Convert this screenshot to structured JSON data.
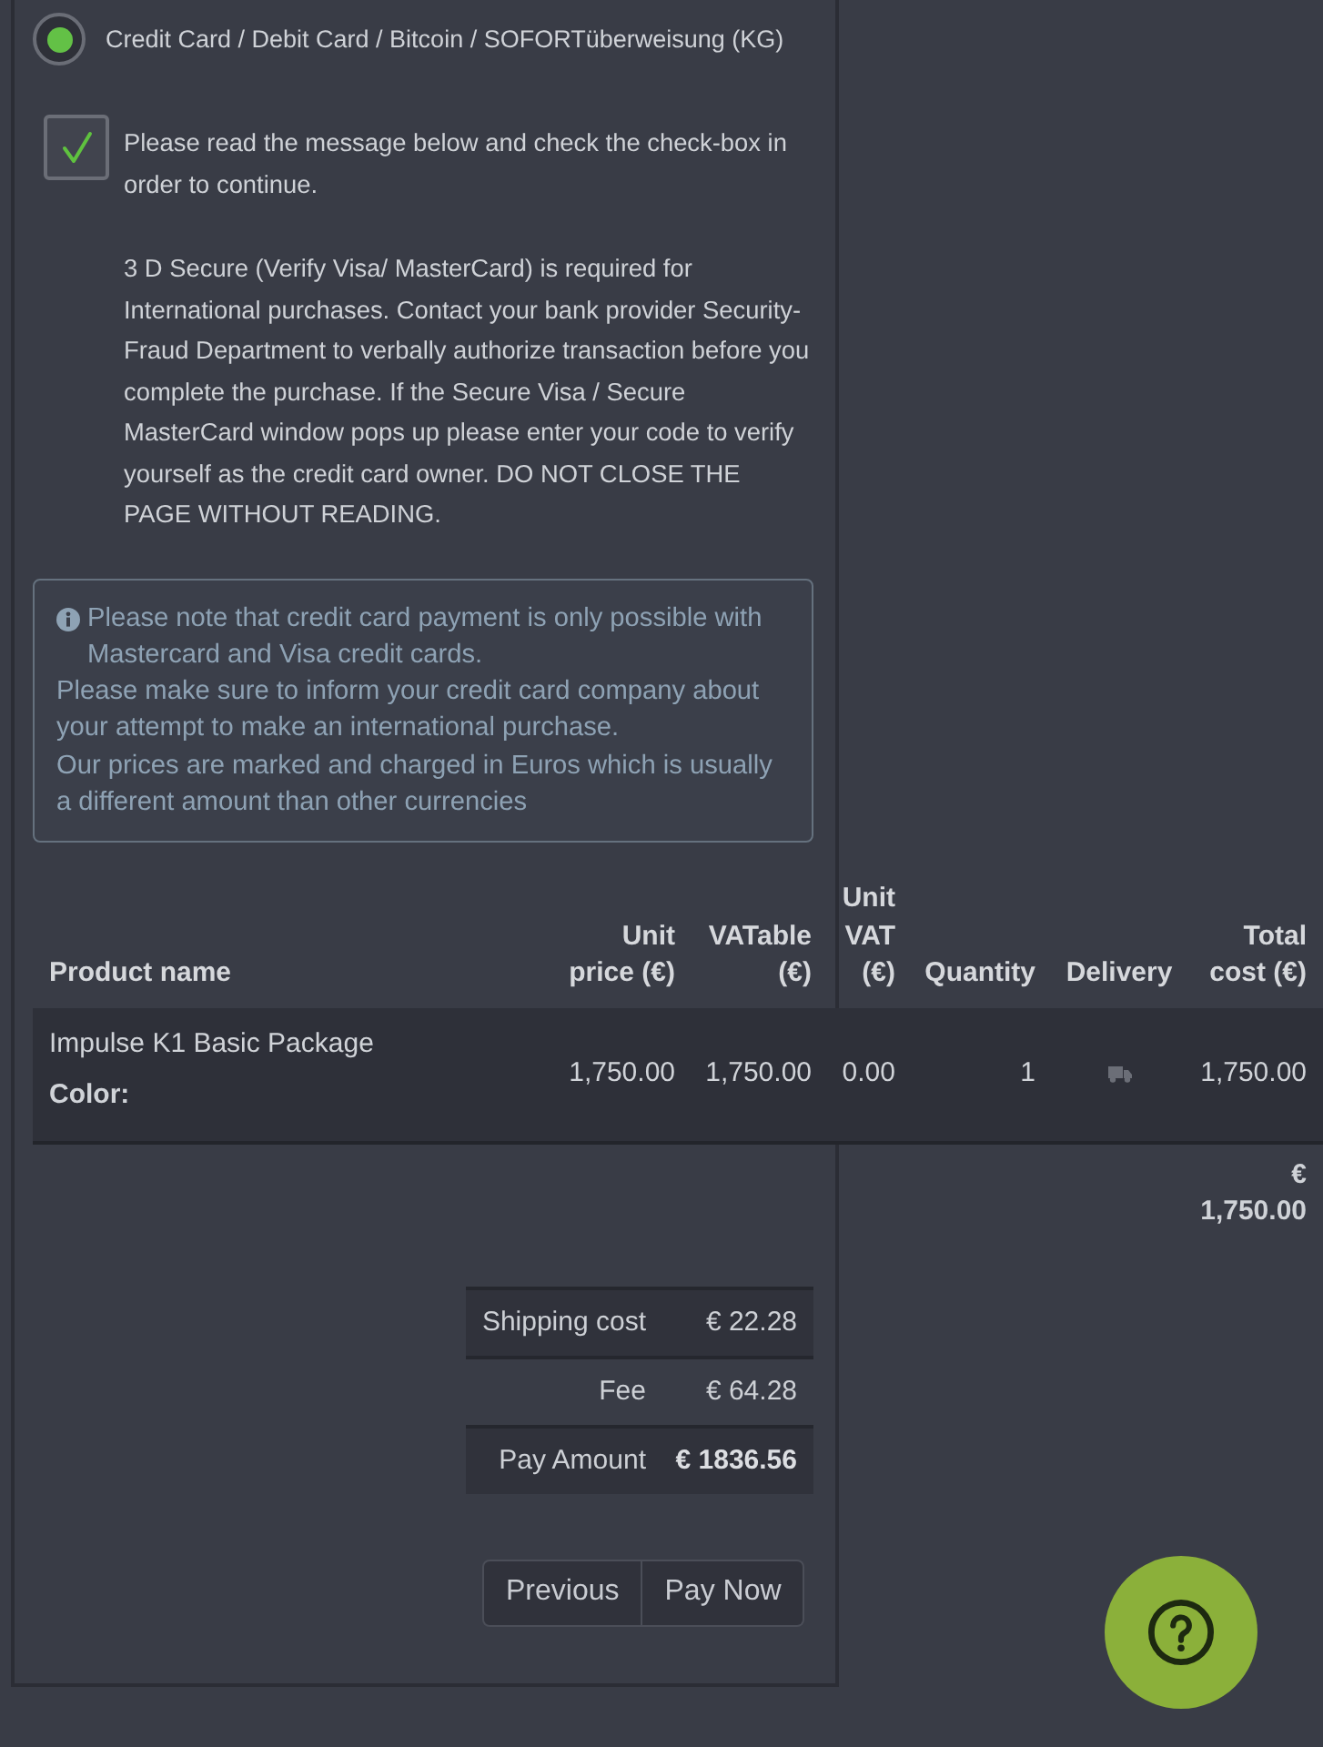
{
  "payment_method": {
    "label": "Credit Card / Debit Card / Bitcoin / SOFORTüberweisung (KG)",
    "selected": true
  },
  "consent": {
    "checked": true,
    "label": "Please read the message below and check the check-box in order to continue.",
    "message": "3 D Secure (Verify Visa/ MasterCard) is required for International purchases. Contact your bank provider Security-Fraud Department to verbally authorize transaction before you complete the purchase. If the Secure Visa / Secure MasterCard window pops up please enter your code to verify yourself as the credit card owner. DO NOT CLOSE THE PAGE WITHOUT READING."
  },
  "notice": {
    "lines": [
      "Please note that credit card payment is only possible with Mastercard and Visa credit cards.",
      "Please make sure to inform your credit card company about your attempt to make an international purchase.",
      "Our prices are marked and charged in Euros which is usually a different amount than other currencies"
    ]
  },
  "order_table": {
    "columns": [
      "Product name",
      "Unit price (€)",
      "VATable (€)",
      "Unit VAT (€)",
      "Quantity",
      "Delivery",
      "Total cost (€)"
    ],
    "rows": [
      {
        "product_name": "Impulse K1 Basic Package",
        "color_label": "Color:",
        "unit_price": "1,750.00",
        "vatable": "1,750.00",
        "unit_vat": "0.00",
        "quantity": "1",
        "total_cost": "1,750.00"
      }
    ],
    "total": "€ 1,750.00"
  },
  "summary": [
    {
      "label": "Shipping cost",
      "value": "€ 22.28",
      "emphasized": false
    },
    {
      "label": "Fee",
      "value": "€ 64.28",
      "emphasized": false
    },
    {
      "label": "Pay Amount",
      "value": "€ 1836.56",
      "emphasized": true
    }
  ],
  "buttons": [
    "Previous",
    "Pay Now"
  ]
}
